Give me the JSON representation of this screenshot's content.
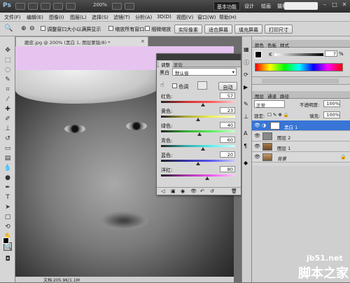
{
  "titlebar": {
    "app_icon": "Ps",
    "zoom": "200%",
    "workspaces": [
      "基本功能",
      "设计",
      "绘画",
      "摄影"
    ],
    "more": "»"
  },
  "menu": [
    "文件(F)",
    "编辑(E)",
    "图像(I)",
    "图层(L)",
    "选择(S)",
    "滤镜(T)",
    "分析(A)",
    "3D(D)",
    "视图(V)",
    "窗口(W)",
    "帮助(H)"
  ],
  "options": {
    "cb1": "调整窗口大小以满屏显示",
    "cb2": "缩放所有窗口",
    "cb3": "细微缩放",
    "buttons": [
      "实际像素",
      "适合屏幕",
      "填充屏幕",
      "打印尺寸"
    ]
  },
  "document": {
    "tab_title": "磨皮.jpg @ 200% (黑白 1, 图层蒙版/8) *",
    "status": "文档:205.9K/1.1M"
  },
  "adjustments": {
    "tab_active": "调整",
    "tab_inactive": "蒙版",
    "preset_label": "黑白",
    "preset_value": "默认值",
    "tint_label": "色调",
    "auto_button": "自动",
    "sliders": [
      {
        "label": "红色:",
        "value": "57",
        "fraction": 0.57,
        "gradient": "linear-gradient(90deg,#222,#c33,#f55,#fcc)"
      },
      {
        "label": "黄色:",
        "value": "23",
        "fraction": 0.5,
        "gradient": "linear-gradient(90deg,#222,#aa3,#ee5,#ffc)"
      },
      {
        "label": "绿色:",
        "value": "40",
        "fraction": 0.52,
        "gradient": "linear-gradient(90deg,#222,#3a3,#5e5,#cfc)"
      },
      {
        "label": "青色:",
        "value": "60",
        "fraction": 0.57,
        "gradient": "linear-gradient(90deg,#222,#3aa,#5ee,#cff)"
      },
      {
        "label": "蓝色:",
        "value": "20",
        "fraction": 0.5,
        "gradient": "linear-gradient(90deg,#222,#33a,#55e,#ccf)"
      },
      {
        "label": "洋红:",
        "value": "80",
        "fraction": 0.62,
        "gradient": "linear-gradient(90deg,#222,#a3a,#e5e,#fcf)"
      }
    ]
  },
  "color_panel": {
    "tabs": [
      "颜色",
      "色板",
      "样式"
    ],
    "channel": "K",
    "value": "7",
    "unit": "%"
  },
  "layers_panel": {
    "tabs": [
      "图层",
      "通道",
      "路径"
    ],
    "blend_mode": "正常",
    "opacity_label": "不透明度:",
    "opacity_value": "100%",
    "lock_label": "锁定:",
    "fill_label": "填充:",
    "fill_value": "100%",
    "layers": [
      {
        "name": "黑白 1",
        "selected": true
      },
      {
        "name": "图层 2",
        "selected": false
      },
      {
        "name": "图层 1",
        "selected": false
      },
      {
        "name": "背景",
        "selected": false
      }
    ]
  },
  "watermark": {
    "url": "jb51.net",
    "name": "脚本之家"
  },
  "colors": {
    "canvas_bg": "#e6c4f0",
    "selection": "#3875d7",
    "accent": "#2e5bb8"
  }
}
